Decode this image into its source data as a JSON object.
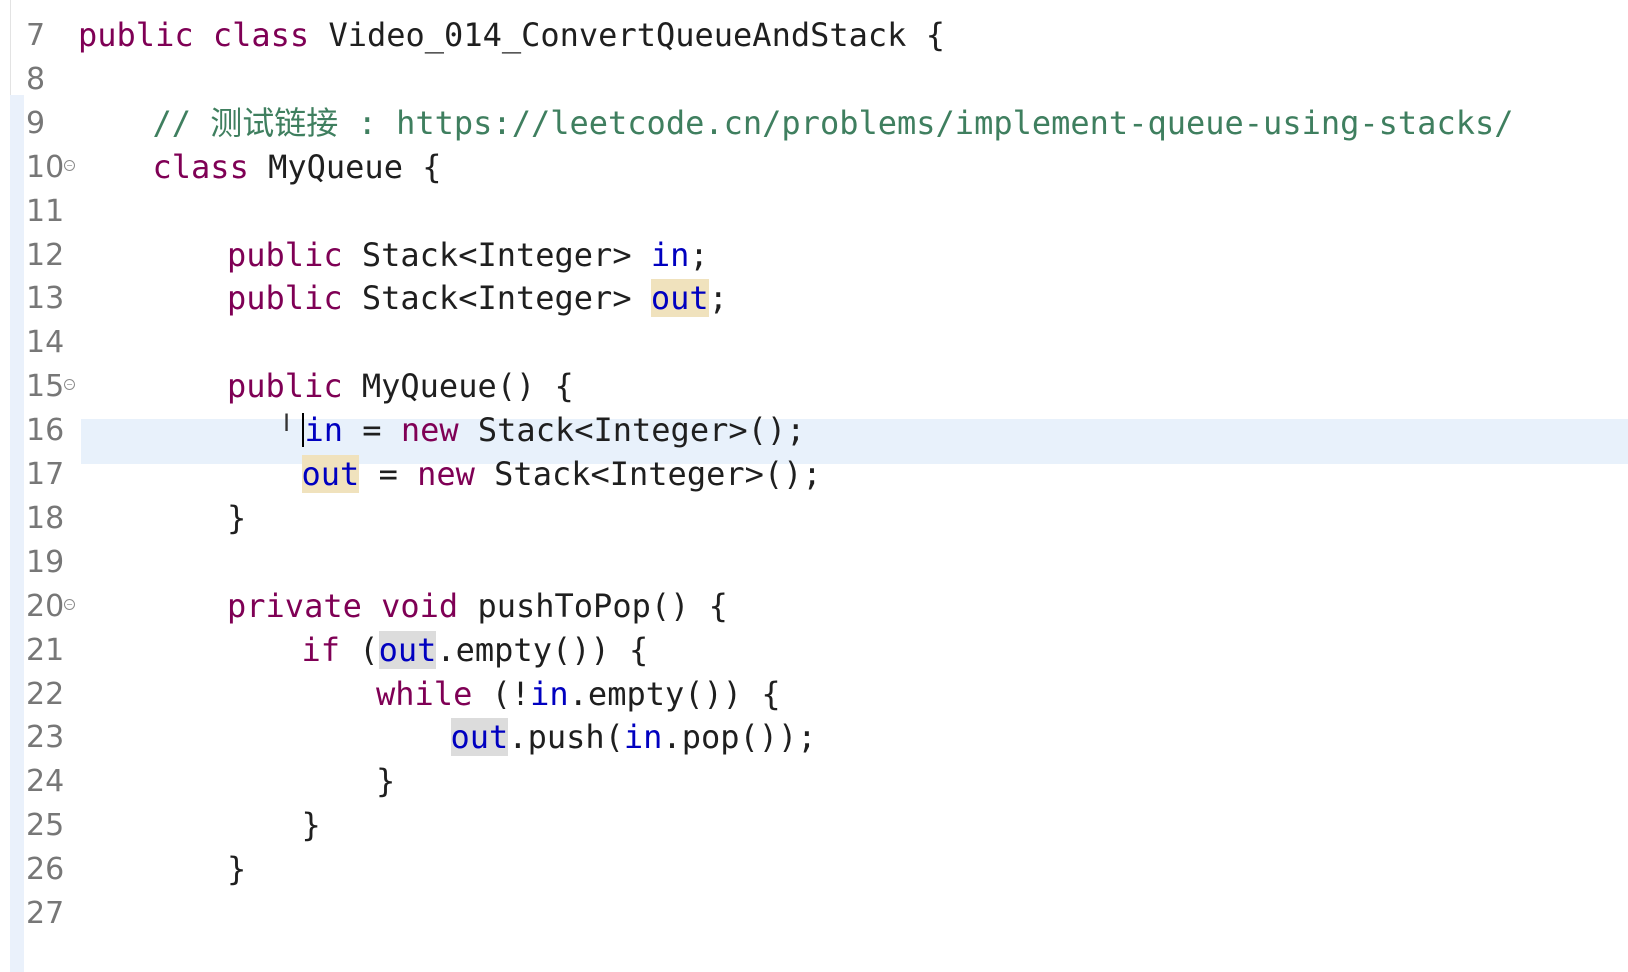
{
  "editor": {
    "lines": [
      {
        "number": "7",
        "fold": "",
        "indent": 0,
        "tokens": [
          {
            "t": "kw",
            "v": "public"
          },
          {
            "t": "plain",
            "v": " "
          },
          {
            "t": "kw",
            "v": "class"
          },
          {
            "t": "plain",
            "v": " Video_014_ConvertQueueAndStack {"
          }
        ]
      },
      {
        "number": "8",
        "fold": "",
        "indent": 0,
        "tokens": []
      },
      {
        "number": "9",
        "fold": "",
        "indent": 1,
        "tokens": [
          {
            "t": "cmt",
            "v": "// 测试链接 : https://leetcode.cn/problems/implement-queue-using-stacks/"
          }
        ]
      },
      {
        "number": "10",
        "fold": "⊖",
        "indent": 1,
        "tokens": [
          {
            "t": "kw",
            "v": "class"
          },
          {
            "t": "plain",
            "v": " MyQueue {"
          }
        ]
      },
      {
        "number": "11",
        "fold": "",
        "indent": 0,
        "tokens": []
      },
      {
        "number": "12",
        "fold": "",
        "indent": 2,
        "tokens": [
          {
            "t": "kw",
            "v": "public"
          },
          {
            "t": "plain",
            "v": " Stack<Integer> "
          },
          {
            "t": "fld",
            "v": "in"
          },
          {
            "t": "plain",
            "v": ";"
          }
        ]
      },
      {
        "number": "13",
        "fold": "",
        "indent": 2,
        "tokens": [
          {
            "t": "kw",
            "v": "public"
          },
          {
            "t": "plain",
            "v": " Stack<Integer> "
          },
          {
            "t": "fld occ",
            "v": "out"
          },
          {
            "t": "plain",
            "v": ";"
          }
        ]
      },
      {
        "number": "14",
        "fold": "",
        "indent": 0,
        "tokens": []
      },
      {
        "number": "15",
        "fold": "⊖",
        "indent": 2,
        "tokens": [
          {
            "t": "kw",
            "v": "public"
          },
          {
            "t": "plain",
            "v": " MyQueue() {"
          }
        ]
      },
      {
        "number": "16",
        "fold": "",
        "indent": 3,
        "caret": true,
        "tokens": [
          {
            "t": "fld",
            "v": "in"
          },
          {
            "t": "plain",
            "v": " = "
          },
          {
            "t": "kw",
            "v": "new"
          },
          {
            "t": "plain",
            "v": " Stack<Integer>();"
          }
        ]
      },
      {
        "number": "17",
        "fold": "",
        "indent": 3,
        "tokens": [
          {
            "t": "fld occ",
            "v": "out"
          },
          {
            "t": "plain",
            "v": " = "
          },
          {
            "t": "kw",
            "v": "new"
          },
          {
            "t": "plain",
            "v": " Stack<Integer>();"
          }
        ]
      },
      {
        "number": "18",
        "fold": "",
        "indent": 2,
        "tokens": [
          {
            "t": "plain",
            "v": "}"
          }
        ]
      },
      {
        "number": "19",
        "fold": "",
        "indent": 0,
        "tokens": []
      },
      {
        "number": "20",
        "fold": "⊖",
        "indent": 2,
        "tokens": [
          {
            "t": "kw",
            "v": "private"
          },
          {
            "t": "plain",
            "v": " "
          },
          {
            "t": "kw",
            "v": "void"
          },
          {
            "t": "plain",
            "v": " pushToPop() {"
          }
        ]
      },
      {
        "number": "21",
        "fold": "",
        "indent": 3,
        "tokens": [
          {
            "t": "kw",
            "v": "if"
          },
          {
            "t": "plain",
            "v": " ("
          },
          {
            "t": "fld occ2",
            "v": "out"
          },
          {
            "t": "plain",
            "v": ".empty()) {"
          }
        ]
      },
      {
        "number": "22",
        "fold": "",
        "indent": 4,
        "tokens": [
          {
            "t": "kw",
            "v": "while"
          },
          {
            "t": "plain",
            "v": " (!"
          },
          {
            "t": "fld",
            "v": "in"
          },
          {
            "t": "plain",
            "v": ".empty()) {"
          }
        ]
      },
      {
        "number": "23",
        "fold": "",
        "indent": 5,
        "tokens": [
          {
            "t": "fld occ2",
            "v": "out"
          },
          {
            "t": "plain",
            "v": ".push("
          },
          {
            "t": "fld",
            "v": "in"
          },
          {
            "t": "plain",
            "v": ".pop());"
          }
        ]
      },
      {
        "number": "24",
        "fold": "",
        "indent": 4,
        "tokens": [
          {
            "t": "plain",
            "v": "}"
          }
        ]
      },
      {
        "number": "25",
        "fold": "",
        "indent": 3,
        "tokens": [
          {
            "t": "plain",
            "v": "}"
          }
        ]
      },
      {
        "number": "26",
        "fold": "",
        "indent": 2,
        "tokens": [
          {
            "t": "plain",
            "v": "}"
          }
        ]
      },
      {
        "number": "27",
        "fold": "",
        "indent": 0,
        "tokens": []
      }
    ]
  }
}
